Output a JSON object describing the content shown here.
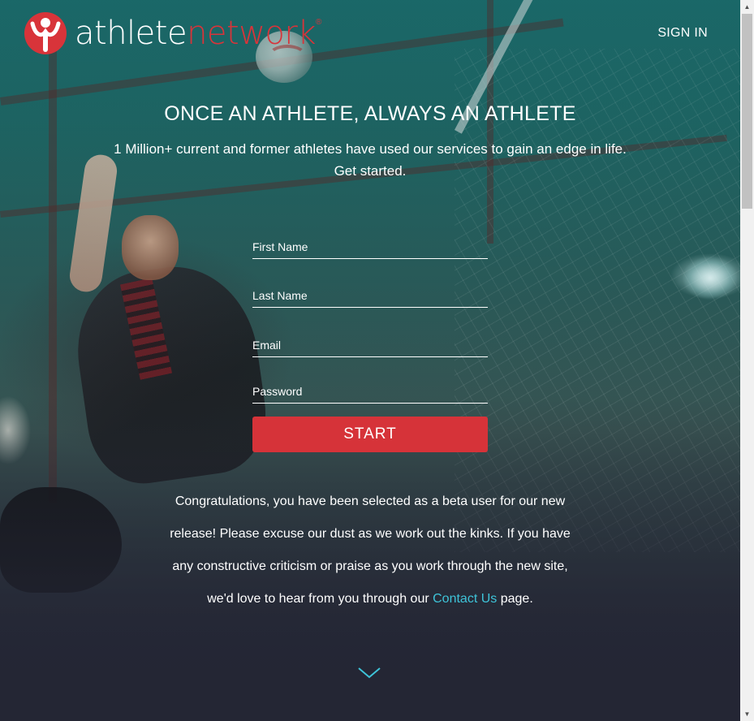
{
  "header": {
    "logo_word_1": "athlete",
    "logo_word_2": "network",
    "logo_reg": "®",
    "signin_label": "SIGN IN"
  },
  "hero": {
    "headline": "ONCE AN ATHLETE, ALWAYS AN ATHLETE",
    "subline_1": "1 Million+ current and former athletes have used our services to gain an edge in life.",
    "subline_2": "Get started."
  },
  "form": {
    "first_name_label": "First Name",
    "last_name_label": "Last Name",
    "email_label": "Email",
    "password_label": "Password",
    "first_name_value": "",
    "last_name_value": "",
    "email_value": "",
    "password_value": "",
    "submit_label": "START"
  },
  "beta_message": {
    "text_before": "Congratulations, you have been selected as a beta user for our new release! Please excuse our dust as we work out the kinks. If you have any constructive criticism or praise as you work through the new site, we'd love to hear from you through our",
    "link_text": "Contact Us",
    "text_after": "page."
  },
  "icons": {
    "logo": "athlete-network-logo",
    "scroll_down": "chevron-down-icon"
  },
  "colors": {
    "brand_red": "#d63339",
    "link_cyan": "#3ec4d9",
    "footer_bg": "#242634"
  },
  "scrollbar": {
    "up_glyph": "▲",
    "down_glyph": "▼"
  }
}
